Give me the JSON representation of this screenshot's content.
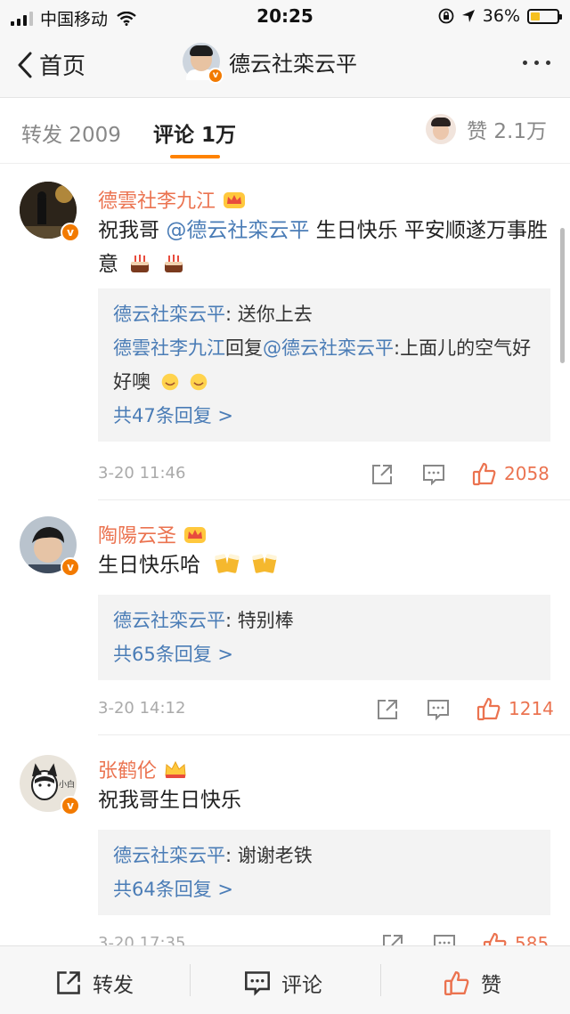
{
  "status_bar": {
    "carrier": "中国移动",
    "time": "20:25",
    "battery": "36%",
    "battery_level": 0.36
  },
  "nav": {
    "back_label": "首页",
    "title": "德云社栾云平"
  },
  "tabs": {
    "repost": "转发 2009",
    "comment": "评论 1万",
    "like": "赞 2.1万"
  },
  "comments": [
    {
      "name": "德雲社李九江",
      "text_prefix": "祝我哥 ",
      "mention": "@德云社栾云平",
      "text_suffix": " 生日快乐 平安顺遂万事胜意",
      "emoji": "cake-icon",
      "replies": [
        {
          "name": "德云社栾云平",
          "text": ": 送你上去"
        },
        {
          "name": "德雲社李九江",
          "text": "回复",
          "mention": "@德云社栾云平",
          "tail": ":上面儿的空气好好噢"
        }
      ],
      "more": "共47条回复 >",
      "time": "3-20 11:46",
      "likes": "2058"
    },
    {
      "name": "陶陽云圣",
      "text": "生日快乐哈",
      "emoji": "beer-icon",
      "replies": [
        {
          "name": "德云社栾云平",
          "text": ": 特别棒"
        }
      ],
      "more": "共65条回复 >",
      "time": "3-20 14:12",
      "likes": "1214"
    },
    {
      "name": "张鹤伦",
      "text": "祝我哥生日快乐",
      "replies": [
        {
          "name": "德云社栾云平",
          "text": ": 谢谢老铁"
        }
      ],
      "more": "共64条回复 >",
      "time": "3-20 17:35",
      "likes": "585"
    }
  ],
  "toolbar": {
    "repost": "转发",
    "comment": "评论",
    "like": "赞"
  },
  "colors": {
    "accent": "#ff8200",
    "username": "#eb7350",
    "link": "#4a7cb6",
    "verified": "#f27a00"
  }
}
